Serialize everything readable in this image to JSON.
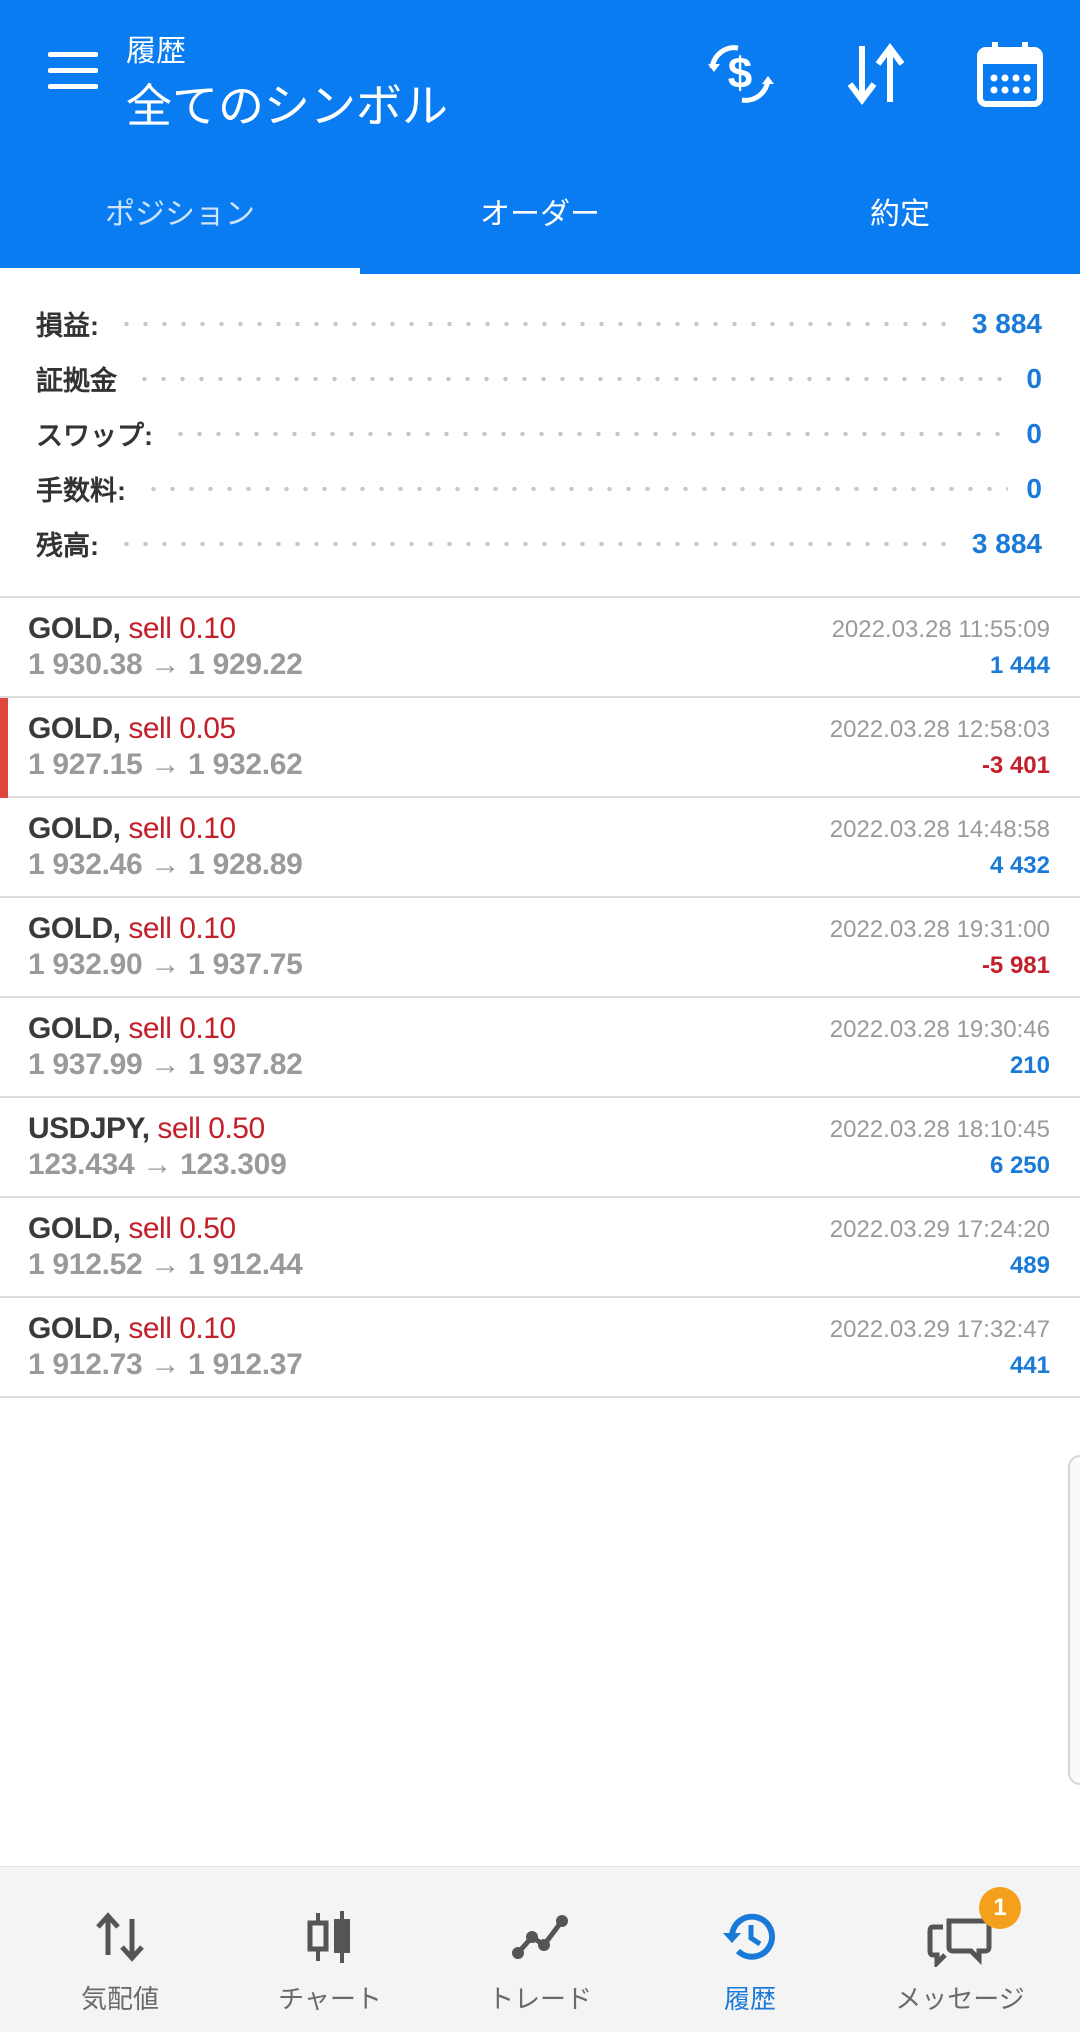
{
  "header": {
    "subtitle": "履歴",
    "title": "全てのシンボル",
    "icons": [
      "menu-icon",
      "currency-exchange-icon",
      "sort-icon",
      "calendar-icon"
    ]
  },
  "tabs": [
    {
      "label": "ポジション",
      "active": true
    },
    {
      "label": "オーダー",
      "active": false
    },
    {
      "label": "約定",
      "active": false
    }
  ],
  "summary": [
    {
      "label": "損益:",
      "value": "3 884"
    },
    {
      "label": "証拠金",
      "value": "0"
    },
    {
      "label": "スワップ:",
      "value": "0"
    },
    {
      "label": "手数料:",
      "value": "0"
    },
    {
      "label": "残高:",
      "value": "3 884"
    }
  ],
  "trades": [
    {
      "symbol": "GOLD,",
      "side": "sell 0.10",
      "prices": "1 930.38 → 1 929.22",
      "time": "2022.03.28 11:55:09",
      "profit": "1 444",
      "profit_sign": "pos"
    },
    {
      "symbol": "GOLD,",
      "side": "sell 0.05",
      "prices": "1 927.15 → 1 932.62",
      "time": "2022.03.28 12:58:03",
      "profit": "-3 401",
      "profit_sign": "neg",
      "highlight": true
    },
    {
      "symbol": "GOLD,",
      "side": "sell 0.10",
      "prices": "1 932.46 → 1 928.89",
      "time": "2022.03.28 14:48:58",
      "profit": "4 432",
      "profit_sign": "pos"
    },
    {
      "symbol": "GOLD,",
      "side": "sell 0.10",
      "prices": "1 932.90 → 1 937.75",
      "time": "2022.03.28 19:31:00",
      "profit": "-5 981",
      "profit_sign": "neg"
    },
    {
      "symbol": "GOLD,",
      "side": "sell 0.10",
      "prices": "1 937.99 → 1 937.82",
      "time": "2022.03.28 19:30:46",
      "profit": "210",
      "profit_sign": "pos"
    },
    {
      "symbol": "USDJPY,",
      "side": "sell 0.50",
      "prices": "123.434 → 123.309",
      "time": "2022.03.28 18:10:45",
      "profit": "6 250",
      "profit_sign": "pos"
    },
    {
      "symbol": "GOLD,",
      "side": "sell 0.50",
      "prices": "1 912.52 → 1 912.44",
      "time": "2022.03.29 17:24:20",
      "profit": "489",
      "profit_sign": "pos"
    },
    {
      "symbol": "GOLD,",
      "side": "sell 0.10",
      "prices": "1 912.73 → 1 912.37",
      "time": "2022.03.29 17:32:47",
      "profit": "441",
      "profit_sign": "pos"
    }
  ],
  "bottom_nav": [
    {
      "label": "気配値",
      "icon": "quotes-icon",
      "active": false
    },
    {
      "label": "チャート",
      "icon": "chart-icon",
      "active": false
    },
    {
      "label": "トレード",
      "icon": "trade-icon",
      "active": false
    },
    {
      "label": "履歴",
      "icon": "history-icon",
      "active": true
    },
    {
      "label": "メッセージ",
      "icon": "messages-icon",
      "active": false,
      "badge": "1"
    }
  ],
  "colors": {
    "primary": "#0a7cf2",
    "profit": "#1a7ad8",
    "loss": "#c2202a",
    "badge": "#f5a01c"
  }
}
